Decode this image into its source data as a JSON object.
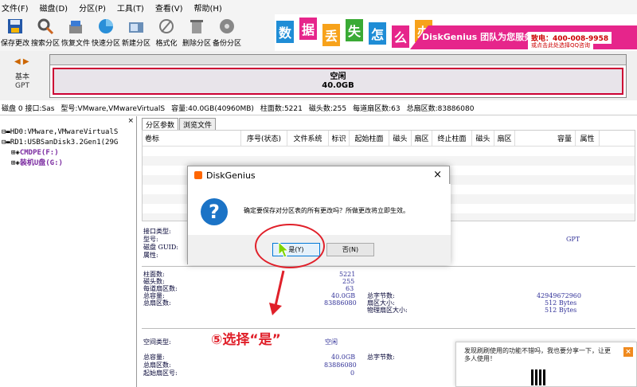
{
  "menu": [
    "文件(F)",
    "磁盘(D)",
    "分区(P)",
    "工具(T)",
    "查看(V)",
    "帮助(H)"
  ],
  "toolbar": [
    {
      "label": "保存更改",
      "icon": "save-icon"
    },
    {
      "label": "搜索分区",
      "icon": "search-icon"
    },
    {
      "label": "恢复文件",
      "icon": "recover-icon"
    },
    {
      "label": "快速分区",
      "icon": "quick-partition-icon"
    },
    {
      "label": "新建分区",
      "icon": "new-partition-icon"
    },
    {
      "label": "格式化",
      "icon": "format-icon"
    },
    {
      "label": "删除分区",
      "icon": "trash-icon"
    },
    {
      "label": "备份分区",
      "icon": "backup-icon"
    }
  ],
  "banner": {
    "tiles": [
      "数",
      "据",
      "丢",
      "失",
      "怎",
      "么",
      "办"
    ],
    "tile_colors": [
      "#1f8dd6",
      "#e6258b",
      "#f7a21b",
      "#3aaa35",
      "#1f8dd6",
      "#e6258b",
      "#f7a21b"
    ],
    "slogan": "DiskGenius 团队为您服务",
    "phone": "致电：400-008-9958",
    "qq": "或点击此处选择QQ咨询"
  },
  "disk_panel": {
    "nav": "◀ ▶",
    "type_line1": "基本",
    "type_line2": "GPT",
    "free_label": "空闲",
    "free_size": "40.0GB"
  },
  "disk_info": [
    "磁盘 0 接口:Sas",
    "型号:VMware,VMwareVirtualS",
    "容量:40.0GB(40960MB)",
    "柱面数:5221",
    "磁头数:255",
    "每道扇区数:63",
    "总扇区数:83886080"
  ],
  "tree": {
    "close": "×",
    "items": [
      {
        "text": "HD0:VMware,VMwareVirtualS",
        "level": 0
      },
      {
        "text": "RD1:USBSanDisk3.2Gen1(29G",
        "level": 0
      },
      {
        "text": "CMDPE(F:)",
        "level": 1
      },
      {
        "text": "装机U盘(G:)",
        "level": 1
      }
    ]
  },
  "tabs": [
    "分区参数",
    "浏览文件"
  ],
  "columns": [
    "卷标",
    "序号(状态)",
    "文件系统",
    "标识",
    "起始柱面",
    "磁头",
    "扇区",
    "终止柱面",
    "磁头",
    "扇区",
    "容量",
    "属性"
  ],
  "params": {
    "interface_type": "接口类型:",
    "model": "型号:",
    "disk_guid": "磁盘 GUID:",
    "attributes": "属性:",
    "gpt": "GPT",
    "cylinders_label": "柱面数:",
    "cylinders": "5221",
    "heads_label": "磁头数:",
    "heads": "255",
    "sectors_label": "每道扇区数:",
    "sectors": "63",
    "capacity_label": "总容量:",
    "capacity": "40.0GB",
    "total_sectors_label": "总扇区数:",
    "total_sectors": "83886080",
    "total_bytes_label": "总字节数:",
    "total_bytes": "42949672960",
    "sector_size_label": "扇区大小:",
    "sector_size": "512 Bytes",
    "phys_sector_label": "物理扇区大小:",
    "phys_sector": "512 Bytes",
    "space_type_label": "空间类型:",
    "space_type": "空闲",
    "free_capacity_label": "总容量:",
    "free_capacity": "40.0GB",
    "free_bytes_label": "总字节数:",
    "free_sectors_label": "总扇区数:",
    "free_sectors": "83886080",
    "start_sector_label": "起始扇区号:",
    "start_sector": "0"
  },
  "dialog": {
    "title": "DiskGenius",
    "close": "×",
    "icon": "?",
    "message": "确定要保存对分区表的所有更改吗？所做更改将立即生效。",
    "yes": "是(Y)",
    "no": "否(N)"
  },
  "annotation": "⑤选择“是”",
  "promo": {
    "text": "发现刷刷使用的功能不错吗，我也要分享一下，让更多人使用！",
    "close": "×"
  },
  "colors": {
    "accent_red": "#e0202a",
    "dialog_blue": "#0078d7"
  }
}
